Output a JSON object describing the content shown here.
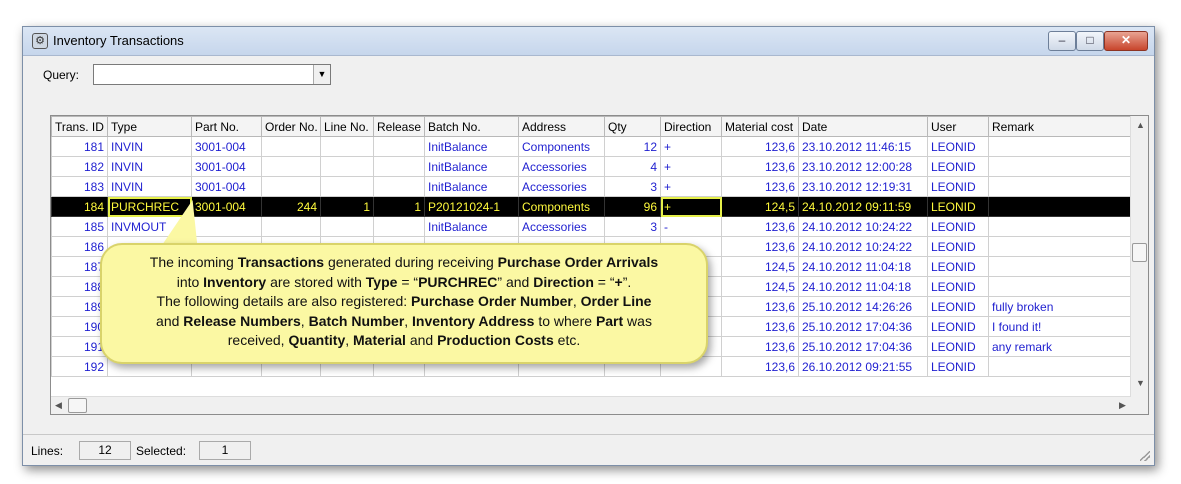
{
  "window": {
    "title": "Inventory Transactions",
    "buttons": {
      "minimize": "–",
      "maximize": "□",
      "close": "✕"
    }
  },
  "query": {
    "label": "Query:",
    "value": ""
  },
  "grid": {
    "columns": [
      "Trans. ID",
      "Type",
      "Part No.",
      "Order No.",
      "Line No.",
      "Release",
      "Batch No.",
      "Address",
      "Qty",
      "Direction",
      "Material cost",
      "Date",
      "User",
      "Remark"
    ],
    "rows": [
      [
        "181",
        "INVIN",
        "3001-004",
        "",
        "",
        "",
        "InitBalance",
        "Components",
        "12",
        "+",
        "123,6",
        "23.10.2012 11:46:15",
        "LEONID",
        ""
      ],
      [
        "182",
        "INVIN",
        "3001-004",
        "",
        "",
        "",
        "InitBalance",
        "Accessories",
        "4",
        "+",
        "123,6",
        "23.10.2012 12:00:28",
        "LEONID",
        ""
      ],
      [
        "183",
        "INVIN",
        "3001-004",
        "",
        "",
        "",
        "InitBalance",
        "Accessories",
        "3",
        "+",
        "123,6",
        "23.10.2012 12:19:31",
        "LEONID",
        ""
      ],
      [
        "184",
        "PURCHREC",
        "3001-004",
        "244",
        "1",
        "1",
        "P20121024-1",
        "Components",
        "96",
        "+",
        "124,5",
        "24.10.2012 09:11:59",
        "LEONID",
        ""
      ],
      [
        "185",
        "INVMOUT",
        "",
        "",
        "",
        "",
        "InitBalance",
        "Accessories",
        "3",
        "-",
        "123,6",
        "24.10.2012 10:24:22",
        "LEONID",
        ""
      ],
      [
        "186",
        "",
        "",
        "",
        "",
        "",
        "",
        "",
        "",
        "",
        "123,6",
        "24.10.2012 10:24:22",
        "LEONID",
        ""
      ],
      [
        "187",
        "",
        "",
        "",
        "",
        "",
        "",
        "",
        "",
        "",
        "124,5",
        "24.10.2012 11:04:18",
        "LEONID",
        ""
      ],
      [
        "188",
        "",
        "",
        "",
        "",
        "",
        "",
        "",
        "",
        "",
        "124,5",
        "24.10.2012 11:04:18",
        "LEONID",
        ""
      ],
      [
        "189",
        "",
        "",
        "",
        "",
        "",
        "",
        "",
        "",
        "",
        "123,6",
        "25.10.2012 14:26:26",
        "LEONID",
        "fully broken"
      ],
      [
        "190",
        "",
        "",
        "",
        "",
        "",
        "",
        "",
        "",
        "",
        "123,6",
        "25.10.2012 17:04:36",
        "LEONID",
        "I found it!"
      ],
      [
        "191",
        "",
        "",
        "",
        "",
        "",
        "",
        "",
        "",
        "",
        "123,6",
        "25.10.2012 17:04:36",
        "LEONID",
        "any remark"
      ],
      [
        "192",
        "",
        "",
        "",
        "",
        "",
        "",
        "",
        "",
        "",
        "123,6",
        "26.10.2012 09:21:55",
        "LEONID",
        ""
      ]
    ],
    "selected_row": 3
  },
  "status": {
    "lines_label": "Lines:",
    "lines": "12",
    "selected_label": "Selected:",
    "selected": "1"
  },
  "callout": {
    "l1a": "The incoming ",
    "l1b": "Transactions",
    "l1c": " generated during receiving ",
    "l1d": "Purchase Order Arrivals",
    "l2a": "into ",
    "l2b": "Inventory",
    "l2c": " are stored with ",
    "l2d": "Type",
    "l2e": " = “",
    "l2f": "PURCHREC",
    "l2g": "” and ",
    "l2h": "Direction",
    "l2i": " = “",
    "l2j": "+",
    "l2k": "”.",
    "l3a": "The following details are also registered: ",
    "l3b": "Purchase Order Number",
    "l3c": ", ",
    "l3d": "Order Line",
    "l4a": "and ",
    "l4b": "Release Numbers",
    "l4c": ", ",
    "l4d": "Batch Number",
    "l4e": ", ",
    "l4f": "Inventory Address",
    "l4g": " to where ",
    "l4h": "Part",
    "l4i": " was",
    "l5a": "received, ",
    "l5b": "Quantity",
    "l5c": ", ",
    "l5d": "Material",
    "l5e": " and ",
    "l5f": "Production",
    "l5g": "  ",
    "l5h": "Costs",
    "l5i": " etc."
  }
}
